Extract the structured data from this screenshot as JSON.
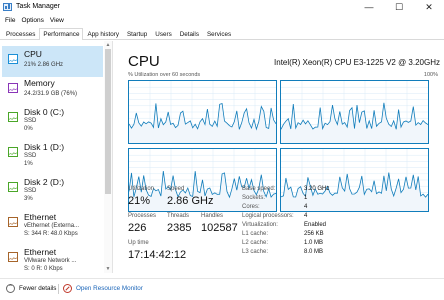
{
  "window": {
    "title": "Task Manager",
    "minimize": "—",
    "maximize": "☐",
    "close": "✕"
  },
  "menu": [
    "File",
    "Options",
    "View"
  ],
  "tabs": [
    {
      "label": "Processes",
      "active": false
    },
    {
      "label": "Performance",
      "active": true
    },
    {
      "label": "App history",
      "active": false
    },
    {
      "label": "Startup",
      "active": false
    },
    {
      "label": "Users",
      "active": false
    },
    {
      "label": "Details",
      "active": false
    },
    {
      "label": "Services",
      "active": false
    }
  ],
  "sidebar": {
    "items": [
      {
        "name": "CPU",
        "lines": [
          "21% 2.86 GHz"
        ],
        "kind": "cpu",
        "selected": true
      },
      {
        "name": "Memory",
        "lines": [
          "24.2/31.9 GB (76%)"
        ],
        "kind": "mem",
        "selected": false
      },
      {
        "name": "Disk 0 (C:)",
        "lines": [
          "SSD",
          "0%"
        ],
        "kind": "disk",
        "selected": false
      },
      {
        "name": "Disk 1 (D:)",
        "lines": [
          "SSD",
          "1%"
        ],
        "kind": "disk",
        "selected": false
      },
      {
        "name": "Disk 2 (D:)",
        "lines": [
          "SSD",
          "3%"
        ],
        "kind": "disk",
        "selected": false
      },
      {
        "name": "Ethernet",
        "lines": [
          "vEthernet (Externa...",
          "S: 344  R: 48.0 Kbps"
        ],
        "kind": "eth",
        "selected": false
      },
      {
        "name": "Ethernet",
        "lines": [
          "VMware Network ...",
          "S: 0  R: 0 Kbps"
        ],
        "kind": "eth",
        "selected": false
      }
    ]
  },
  "main": {
    "title": "CPU",
    "model": "Intel(R) Xeon(R) CPU E3-1225 V2 @ 3.20GHz",
    "util_label": "% Utilization over 60 seconds",
    "util_max": "100%",
    "graph_color": "#117dbb",
    "stats": {
      "utilization_label": "Utilization",
      "utilization": "21%",
      "speed_label": "Speed",
      "speed": "2.86 GHz",
      "processes_label": "Processes",
      "processes": "226",
      "threads_label": "Threads",
      "threads": "2385",
      "handles_label": "Handles",
      "handles": "102587",
      "uptime_label": "Up time",
      "uptime": "17:14:42:12"
    },
    "specs": [
      {
        "label": "Base speed:",
        "value": "3.20 GHz"
      },
      {
        "label": "Sockets:",
        "value": "1"
      },
      {
        "label": "Cores:",
        "value": "4"
      },
      {
        "label": "Logical processors:",
        "value": "4"
      },
      {
        "label": "Virtualization:",
        "value": "Enabled"
      },
      {
        "label": "L1 cache:",
        "value": "256 KB"
      },
      {
        "label": "L2 cache:",
        "value": "1.0 MB"
      },
      {
        "label": "L3 cache:",
        "value": "8.0 MB"
      }
    ]
  },
  "footer": {
    "fewer_details": "Fewer details",
    "open_rm": "Open Resource Monitor"
  }
}
